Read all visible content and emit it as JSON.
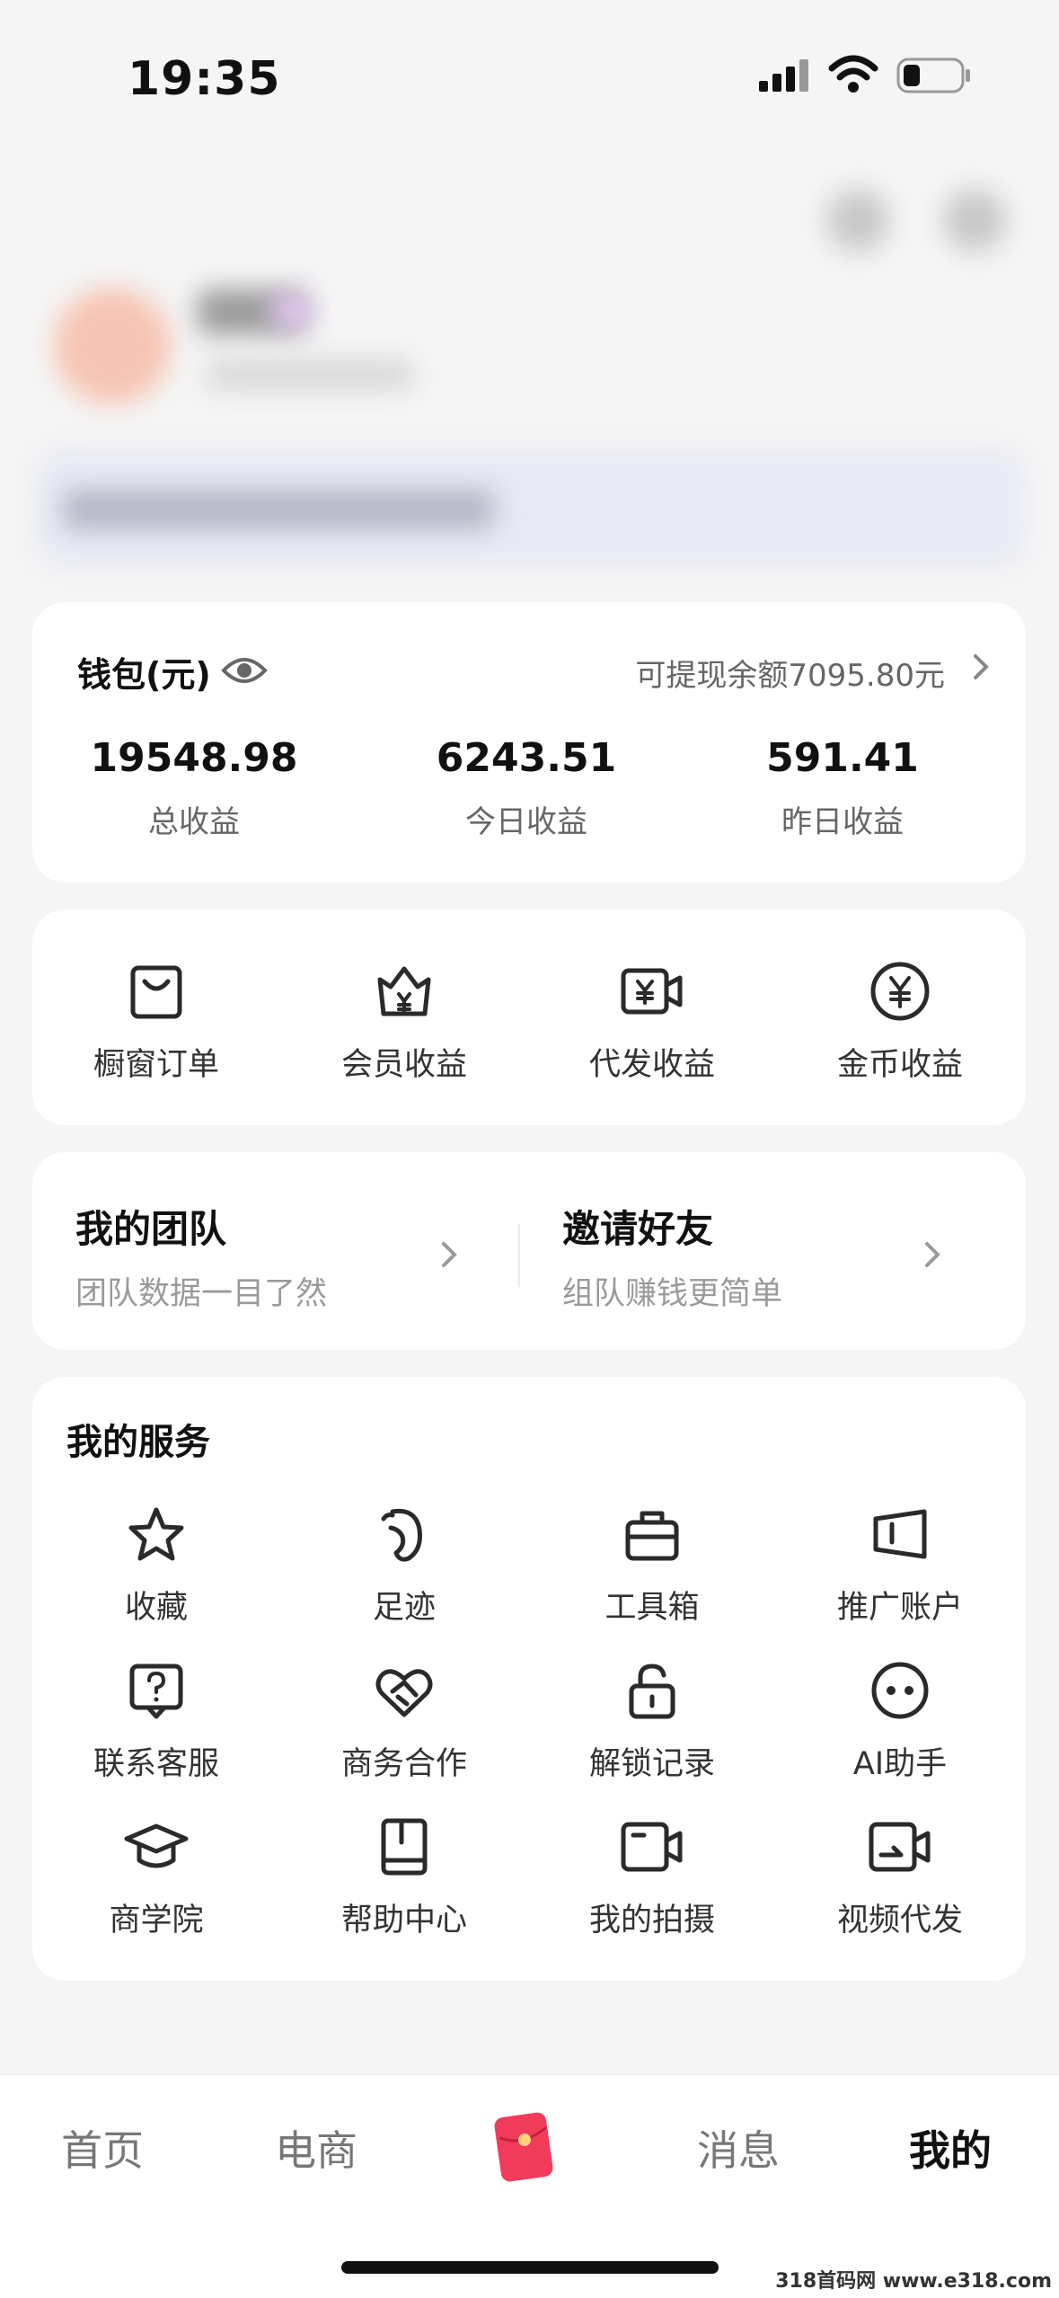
{
  "status": {
    "time": "19:35"
  },
  "wallet": {
    "title": "钱包(元)",
    "available": "可提现余额7095.80元",
    "stats": [
      {
        "value": "19548.98",
        "label": "总收益"
      },
      {
        "value": "6243.51",
        "label": "今日收益"
      },
      {
        "value": "591.41",
        "label": "昨日收益"
      }
    ]
  },
  "earnings": [
    {
      "label": "橱窗订单",
      "icon": "shopping-bag-icon"
    },
    {
      "label": "会员收益",
      "icon": "crown-yen-icon"
    },
    {
      "label": "代发收益",
      "icon": "video-yen-icon"
    },
    {
      "label": "金币收益",
      "icon": "coin-yen-icon"
    }
  ],
  "team": {
    "left": {
      "title": "我的团队",
      "subtitle": "团队数据一目了然"
    },
    "right": {
      "title": "邀请好友",
      "subtitle": "组队赚钱更简单"
    }
  },
  "services": {
    "title": "我的服务",
    "items": [
      {
        "label": "收藏",
        "icon": "star-icon"
      },
      {
        "label": "足迹",
        "icon": "footprint-icon"
      },
      {
        "label": "工具箱",
        "icon": "toolbox-icon"
      },
      {
        "label": "推广账户",
        "icon": "ad-account-icon"
      },
      {
        "label": "联系客服",
        "icon": "help-chat-icon"
      },
      {
        "label": "商务合作",
        "icon": "heart-handshake-icon"
      },
      {
        "label": "解锁记录",
        "icon": "unlock-icon"
      },
      {
        "label": "AI助手",
        "icon": "robot-face-icon"
      },
      {
        "label": "商学院",
        "icon": "graduation-cap-icon"
      },
      {
        "label": "帮助中心",
        "icon": "book-icon"
      },
      {
        "label": "我的拍摄",
        "icon": "video-camera-icon"
      },
      {
        "label": "视频代发",
        "icon": "video-forward-icon"
      }
    ]
  },
  "tabbar": {
    "items": [
      {
        "label": "首页"
      },
      {
        "label": "电商"
      },
      {
        "label": "消息"
      },
      {
        "label": "我的"
      }
    ],
    "center_icon": "red-envelope-icon",
    "accent": "#f23a5a"
  },
  "watermark": "318首码网 www.e318.com"
}
